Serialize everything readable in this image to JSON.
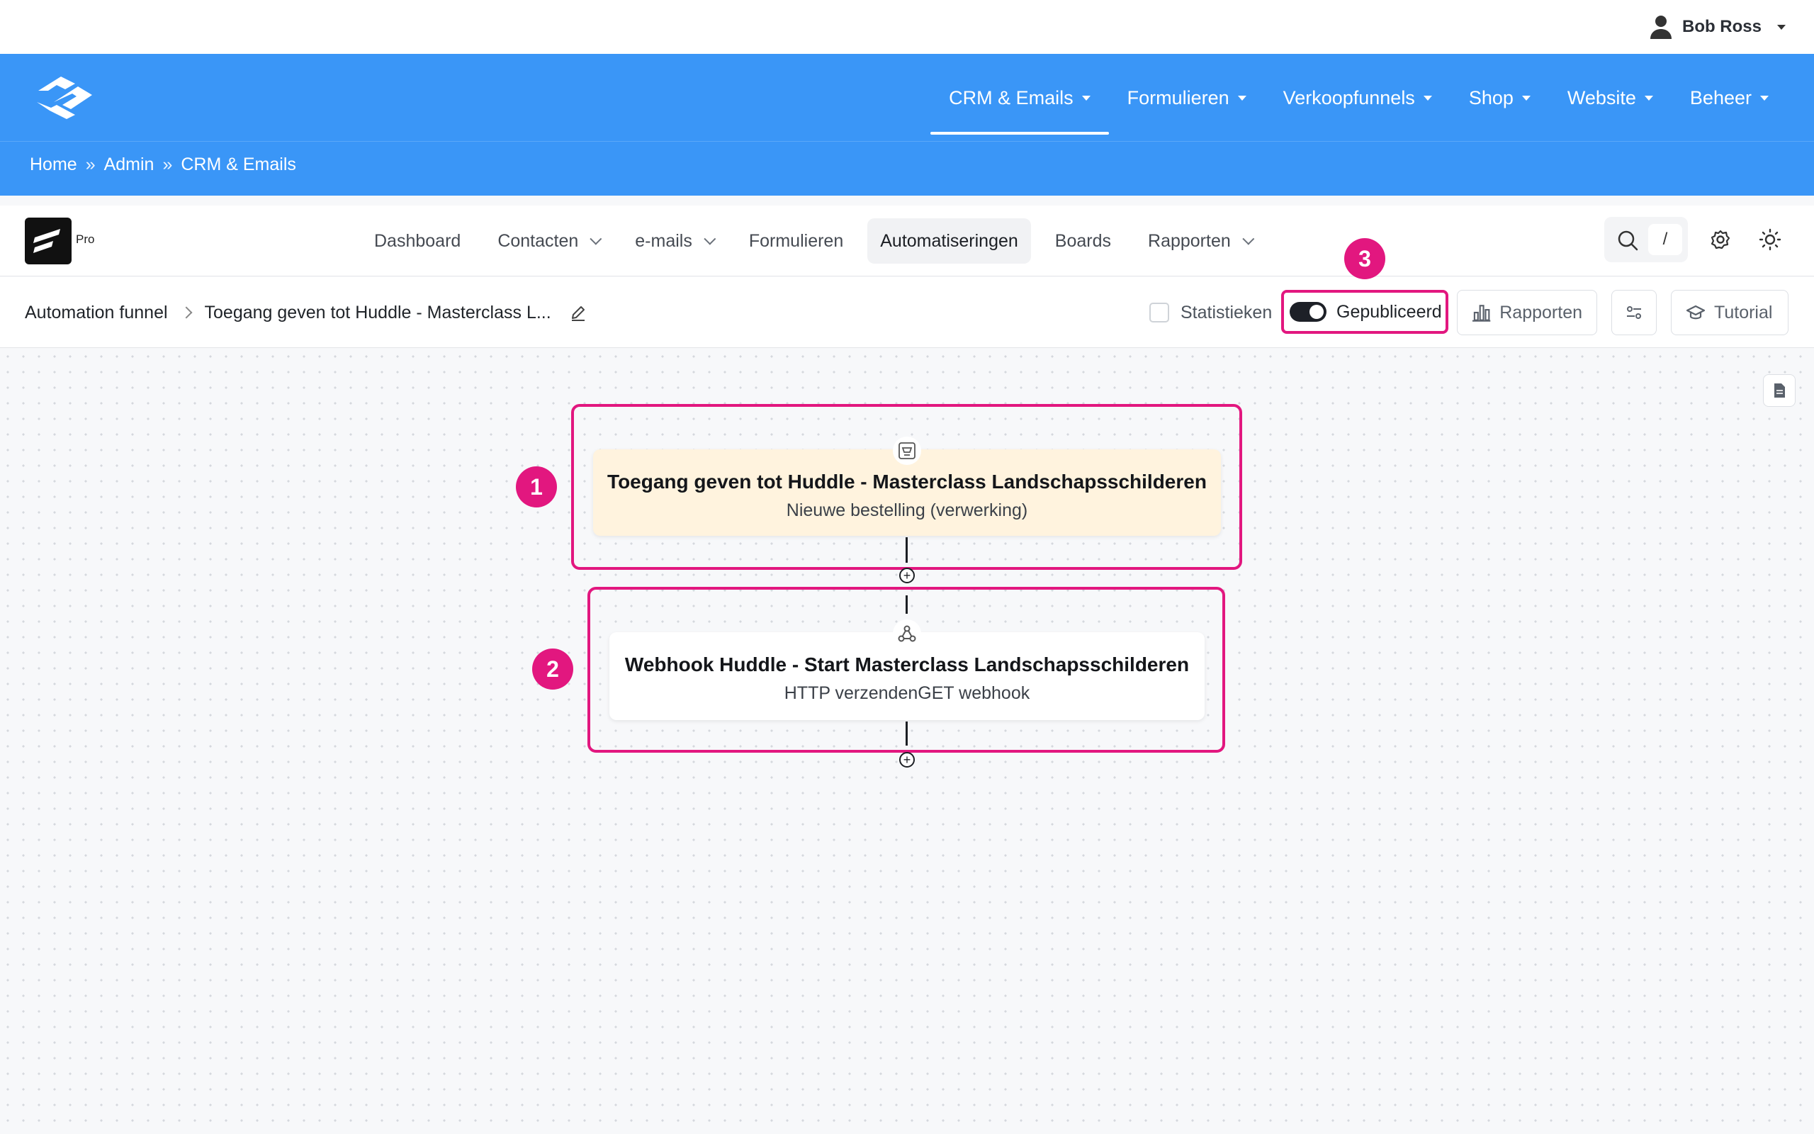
{
  "user": {
    "name": "Bob Ross"
  },
  "main_nav": {
    "items": [
      {
        "label": "CRM & Emails",
        "active": true
      },
      {
        "label": "Formulieren"
      },
      {
        "label": "Verkoopfunnels"
      },
      {
        "label": "Shop"
      },
      {
        "label": "Website"
      },
      {
        "label": "Beheer"
      }
    ]
  },
  "breadcrumb": {
    "items": [
      "Home",
      "Admin",
      "CRM & Emails"
    ],
    "separator": "»"
  },
  "app": {
    "badge": "Pro",
    "nav": [
      "Dashboard",
      "Contacten",
      "e-mails",
      "Formulieren",
      "Automatiseringen",
      "Boards",
      "Rapporten"
    ],
    "active_nav": "Automatiseringen",
    "search_shortcut": "/"
  },
  "toolbar": {
    "crumb_root": "Automation funnel",
    "crumb_current": "Toegang geven tot Huddle - Masterclass L...",
    "stats_label": "Statistieken",
    "published_label": "Gepubliceerd",
    "published": true,
    "reports_label": "Rapporten",
    "tutorial_label": "Tutorial"
  },
  "annotations": [
    "1",
    "2",
    "3"
  ],
  "flow": {
    "trigger": {
      "title": "Toegang geven tot Huddle - Masterclass Landschapsschilderen",
      "subtitle": "Nieuwe bestelling (verwerking)"
    },
    "action": {
      "title": "Webhook Huddle - Start Masterclass Landschapsschilderen",
      "subtitle": "HTTP verzendenGET webhook"
    }
  },
  "colors": {
    "brand_blue": "#3a96f7",
    "highlight": "#e2177f",
    "trigger_bg": "#fff3de"
  }
}
